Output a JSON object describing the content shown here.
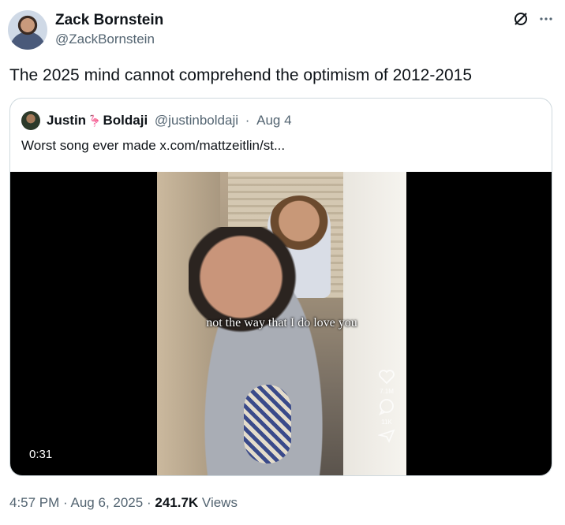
{
  "author": {
    "name": "Zack Bornstein",
    "handle": "@ZackBornstein"
  },
  "icons": {
    "grok": "grok-icon",
    "more": "more-icon"
  },
  "tweet": {
    "text": "The 2025 mind cannot comprehend the optimism of 2012-2015"
  },
  "quote": {
    "name_first": "Justin",
    "name_last": "Boldaji",
    "emoji": "🦩",
    "handle": "@justinboldaji",
    "separator": "·",
    "date": "Aug 4",
    "text": "Worst song ever made  x.com/mattzeitlin/st..."
  },
  "video": {
    "caption": "not the way that I do love you",
    "likes": "7.1M",
    "comments": "11K",
    "duration": "0:31"
  },
  "footer": {
    "time": "4:57 PM",
    "sep1": "·",
    "date": "Aug 6, 2025",
    "sep2": "·",
    "views": "241.7K",
    "views_label": "Views"
  },
  "colors": {
    "text": "#0f1419",
    "secondary": "#536471",
    "border": "#cfd9de"
  }
}
